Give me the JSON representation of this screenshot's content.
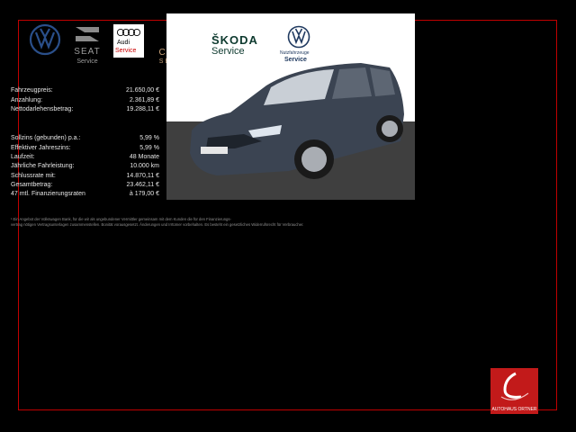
{
  "brands": {
    "seat": {
      "name": "SEAT",
      "sub": "Service"
    },
    "audi": {
      "name": "Audi",
      "sub": "Service"
    },
    "cupra": {
      "name": "CUPRA",
      "sub": "SERVICE"
    },
    "skoda": {
      "name": "ŠKODA",
      "sub": "Service"
    },
    "vwn": {
      "line1": "Nutzfahrzeuge",
      "line2": "Service"
    }
  },
  "financing": {
    "group1": [
      {
        "label": "Fahrzeugpreis:",
        "value": "21.650,00 €"
      },
      {
        "label": "Anzahlung:",
        "value": "2.361,89 €"
      },
      {
        "label": "Nettodarlehensbetrag:",
        "value": "19.288,11 €"
      }
    ],
    "group2": [
      {
        "label": "Sollzins (gebunden) p.a.:",
        "value": "5,99 %"
      },
      {
        "label": "Effektiver Jahreszins:",
        "value": "5,99 %"
      },
      {
        "label": "Laufzeit:",
        "value": "48 Monate"
      },
      {
        "label": "Jährliche Fahrleistung:",
        "value": "10.000 km"
      },
      {
        "label": "Schlussrate mit:",
        "value": "14.870,11 €"
      },
      {
        "label": "Gesamtbetrag:",
        "value": "23.462,11 €"
      },
      {
        "label": "47 mtl. Finanzierungsraten",
        "value": "à 179,00 €"
      }
    ]
  },
  "footnote": {
    "line1": "¹ Ein Angebot der Volkswagen Bank, für die wir als ungebundener Vermittler gemeinsam mit dem Kunden die für den Finanzierungs-",
    "line2": "vertrag nötigen Vertragsunterlagen zusammenstellen. Bonität vorausgesetzt. Änderungen und Irrtümer vorbehalten. Es besteht ein gesetzliches Widerrufsrecht für Verbraucher."
  },
  "dealer": {
    "name": "AUTOHAUS ORTNER"
  },
  "colors": {
    "frame": "#c00000",
    "dealer": "#c21a1a",
    "car": "#3b4452"
  }
}
